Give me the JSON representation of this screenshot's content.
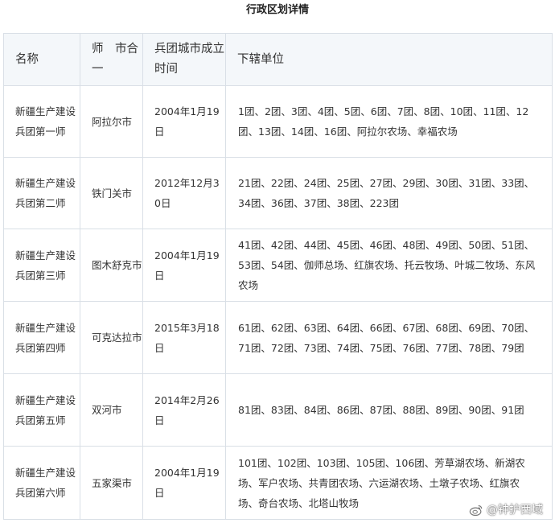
{
  "title": "行政区划详情",
  "table": {
    "headers": [
      "名称",
      "师　市合一",
      "兵团城市成立时间",
      "下辖单位"
    ],
    "rows": [
      {
        "name": "新疆生产建设兵团第一师",
        "city": "阿拉尔市",
        "date": "2004年1月19日",
        "units": "1团、2团、3团、4团、5团、6团、7团、8团、10团、11团、12团、13团、14团、16团、阿拉尔农场、幸福农场"
      },
      {
        "name": "新疆生产建设兵团第二师",
        "city": "铁门关市",
        "date": "2012年12月30日",
        "units": "21团、22团、24团、25团、27团、29团、30团、31团、33团、34团、36团、37团、38团、223团"
      },
      {
        "name": "新疆生产建设兵团第三师",
        "city": "图木舒克市",
        "date": "2004年1月19日",
        "units": "41团、42团、44团、45团、46团、48团、49团、50团、51团、53团、54团、伽师总场、红旗农场、托云牧场、叶城二牧场、东风农场"
      },
      {
        "name": "新疆生产建设兵团第四师",
        "city": "可克达拉市",
        "date": "2015年3月18日",
        "units": "61团、62团、63团、64团、66团、67团、68团、69团、70团、71团、72团、73团、74团、75团、76团、77团、78团、79团"
      },
      {
        "name": "新疆生产建设兵团第五师",
        "city": "双河市",
        "date": "2014年2月26日",
        "units": "81团、83团、84团、86团、87团、88团、89团、90团、91团"
      },
      {
        "name": "新疆生产建设兵团第六师",
        "city": "五家渠市",
        "date": "2004年1月19日",
        "units": "101团、102团、103团、105团、106团、芳草湖农场、新湖农场、军户农场、共青团农场、六运湖农场、土墩子农场、红旗农场、奇台农场、北塔山牧场"
      }
    ]
  },
  "watermark": {
    "text": "@钟护西域",
    "icon": "weibo-logo-icon"
  }
}
